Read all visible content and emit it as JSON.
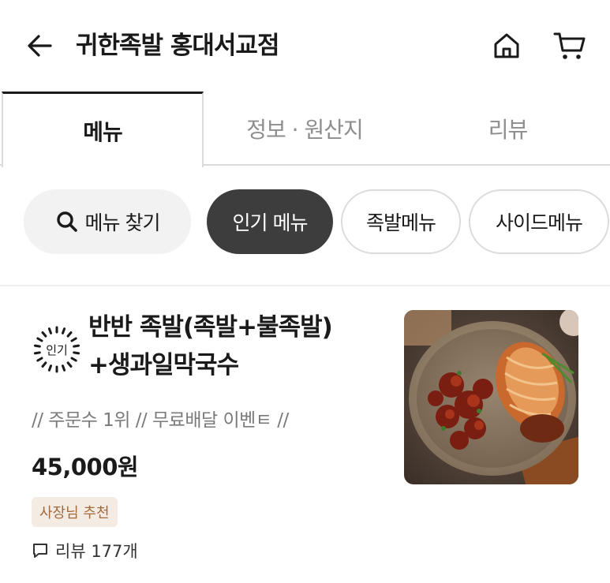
{
  "header": {
    "title": "귀한족발 홍대서교점",
    "icons": {
      "back": "arrow-left-icon",
      "home": "home-icon",
      "cart": "cart-icon"
    }
  },
  "tabs": [
    {
      "label": "메뉴",
      "active": true
    },
    {
      "label": "정보 · 원산지",
      "active": false
    },
    {
      "label": "리뷰",
      "active": false
    }
  ],
  "chips": {
    "search": "메뉴 찾기",
    "items": [
      {
        "label": "인기 메뉴",
        "selected": true
      },
      {
        "label": "족발메뉴",
        "selected": false
      },
      {
        "label": "사이드메뉴",
        "selected": false
      }
    ]
  },
  "menu_item": {
    "popular_badge": "인기",
    "name_line1": "반반 족발(족발+불족발)",
    "name_line2": "+생과일막국수",
    "description": "// 주문수 1위 // 무료배달 이벤ㅌ //",
    "price": "45,000원",
    "tag": "사장님 추천",
    "review": "리뷰 177개"
  },
  "colors": {
    "text": "#1a1a1a",
    "muted": "#8e8e8e",
    "chip_selected_bg": "#3d3d3d",
    "tag_bg": "#f4ebe3",
    "tag_text": "#a36a3c"
  }
}
